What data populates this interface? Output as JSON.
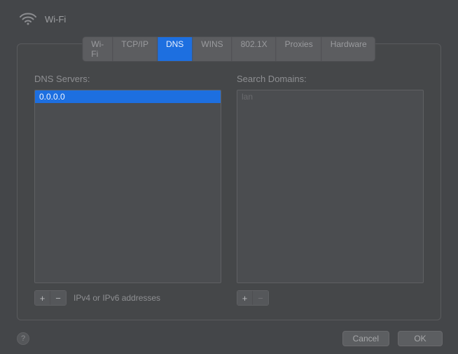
{
  "title": "Wi-Fi",
  "tabs": [
    {
      "label": "Wi-Fi"
    },
    {
      "label": "TCP/IP"
    },
    {
      "label": "DNS"
    },
    {
      "label": "WINS"
    },
    {
      "label": "802.1X"
    },
    {
      "label": "Proxies"
    },
    {
      "label": "Hardware"
    }
  ],
  "dns": {
    "label": "DNS Servers:",
    "entry": "0.0.0.0",
    "hint": "IPv4 or IPv6 addresses",
    "addGlyph": "+",
    "removeGlyph": "−"
  },
  "search": {
    "label": "Search Domains:",
    "placeholder": "lan",
    "addGlyph": "+",
    "removeGlyph": "−"
  },
  "footer": {
    "help": "?",
    "cancel": "Cancel",
    "ok": "OK"
  }
}
